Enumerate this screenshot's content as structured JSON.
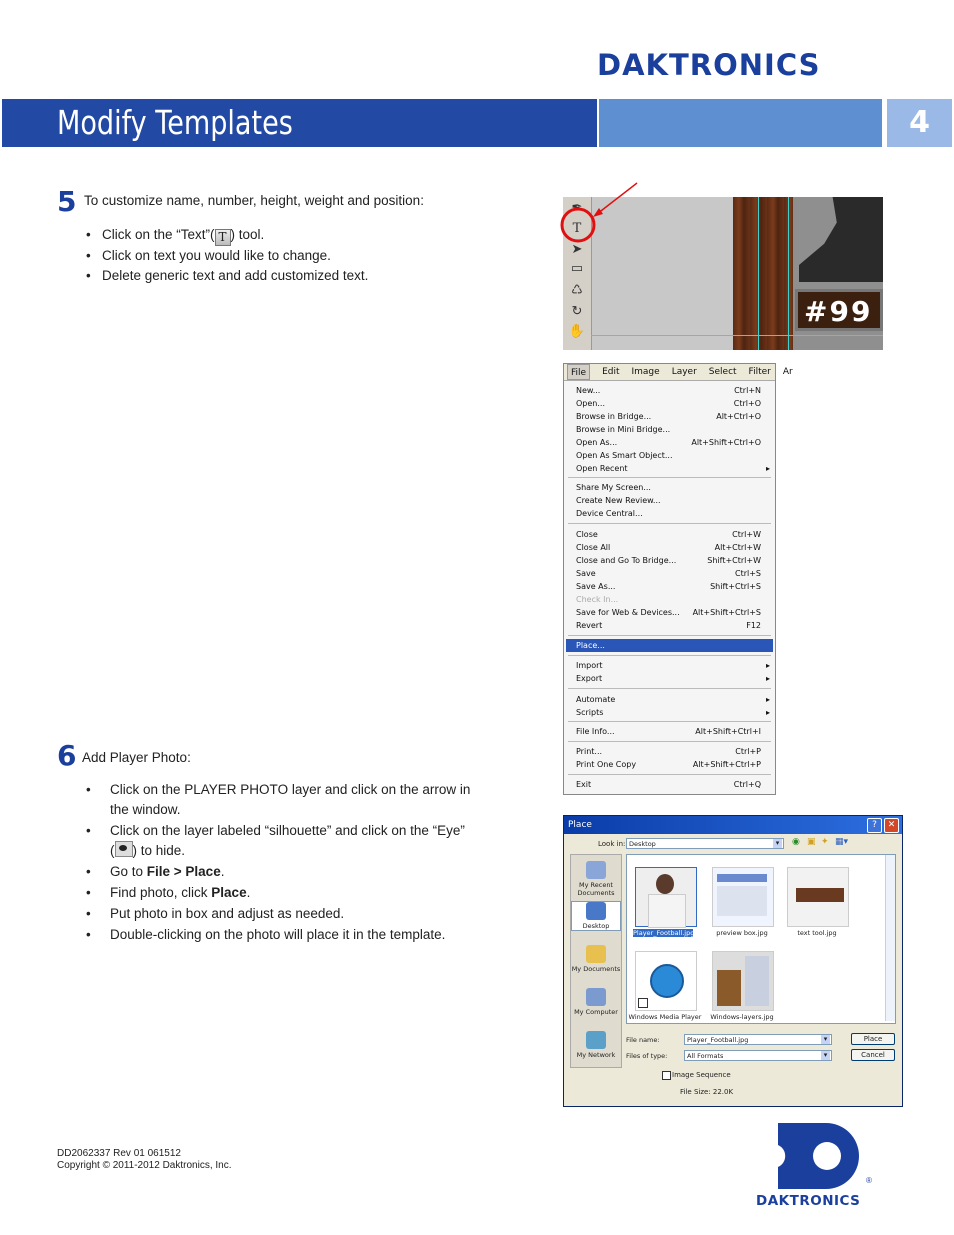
{
  "brand": {
    "logo_text": "DAKTRONICS",
    "bottom_logo_text": "DAKTRONICS",
    "registered": "®",
    "color": "#1b3f9c"
  },
  "header": {
    "title": "Modify Templates",
    "section_number": "4"
  },
  "step5": {
    "number": "5",
    "intro": "To customize name, number, height, weight and position:",
    "bullets": {
      "b1_pre": "Click on the “Text”(",
      "b1_icon": "T",
      "b1_post": ") tool.",
      "b2": "Click on text you would like to change.",
      "b3": "Delete generic text and add customized text."
    }
  },
  "step6": {
    "number": "6",
    "intro": "Add Player Photo:",
    "bullets": {
      "b1": "Click on the PLAYER PHOTO layer and click on the arrow in the window.",
      "b2_pre": "Click on the layer labeled “silhouette” and click on the “Eye” (",
      "b2_post": ") to hide.",
      "b3_pre": "Go to ",
      "b3_bold": "File > Place",
      "b3_post": ".",
      "b4_pre": "Find photo, click ",
      "b4_bold": "Place",
      "b4_post": ".",
      "b5": "Put photo in box and adjust as needed.",
      "b6": "Double-clicking on the photo will place it in the template."
    }
  },
  "toolbar_shot": {
    "jersey_text": "#99"
  },
  "file_menu": {
    "menubar": [
      "File",
      "Edit",
      "Image",
      "Layer",
      "Select",
      "Filter",
      "Ar"
    ],
    "items": [
      {
        "label": "New...",
        "shortcut": "Ctrl+N"
      },
      {
        "label": "Open...",
        "shortcut": "Ctrl+O"
      },
      {
        "label": "Browse in Bridge...",
        "shortcut": "Alt+Ctrl+O"
      },
      {
        "label": "Browse in Mini Bridge...",
        "shortcut": ""
      },
      {
        "label": "Open As...",
        "shortcut": "Alt+Shift+Ctrl+O"
      },
      {
        "label": "Open As Smart Object...",
        "shortcut": ""
      },
      {
        "label": "Open Recent",
        "shortcut": ""
      },
      {
        "label": "Share My Screen...",
        "shortcut": ""
      },
      {
        "label": "Create New Review...",
        "shortcut": ""
      },
      {
        "label": "Device Central...",
        "shortcut": ""
      },
      {
        "label": "Close",
        "shortcut": "Ctrl+W"
      },
      {
        "label": "Close All",
        "shortcut": "Alt+Ctrl+W"
      },
      {
        "label": "Close and Go To Bridge...",
        "shortcut": "Shift+Ctrl+W"
      },
      {
        "label": "Save",
        "shortcut": "Ctrl+S"
      },
      {
        "label": "Save As...",
        "shortcut": "Shift+Ctrl+S"
      },
      {
        "label": "Check In...",
        "shortcut": ""
      },
      {
        "label": "Save for Web & Devices...",
        "shortcut": "Alt+Shift+Ctrl+S"
      },
      {
        "label": "Revert",
        "shortcut": "F12"
      },
      {
        "label": "Place...",
        "shortcut": ""
      },
      {
        "label": "Import",
        "shortcut": ""
      },
      {
        "label": "Export",
        "shortcut": ""
      },
      {
        "label": "Automate",
        "shortcut": ""
      },
      {
        "label": "Scripts",
        "shortcut": ""
      },
      {
        "label": "File Info...",
        "shortcut": "Alt+Shift+Ctrl+I"
      },
      {
        "label": "Print...",
        "shortcut": "Ctrl+P"
      },
      {
        "label": "Print One Copy",
        "shortcut": "Alt+Shift+Ctrl+P"
      },
      {
        "label": "Exit",
        "shortcut": "Ctrl+Q"
      }
    ]
  },
  "place_dialog": {
    "title": "Place",
    "help": "?",
    "close": "✕",
    "look_in_label": "Look in:",
    "look_in_value": "Desktop",
    "places": [
      "My Recent Documents",
      "Desktop",
      "My Documents",
      "My Computer",
      "My Network"
    ],
    "files": [
      "Player_Football.jpg",
      "preview box.jpg",
      "text tool.jpg",
      "Windows Media Player",
      "Windows-layers.jpg"
    ],
    "file_name_label": "File name:",
    "file_name_value": "Player_Football.jpg",
    "file_type_label": "Files of type:",
    "file_type_value": "All Formats",
    "place_button": "Place",
    "cancel_button": "Cancel",
    "image_sequence_label": "Image Sequence",
    "file_size": "File Size: 22.0K"
  },
  "footer": {
    "doc_number": "DD2062337 Rev 01  061512",
    "copyright": "Copyright © 2011-2012 Daktronics, Inc."
  }
}
